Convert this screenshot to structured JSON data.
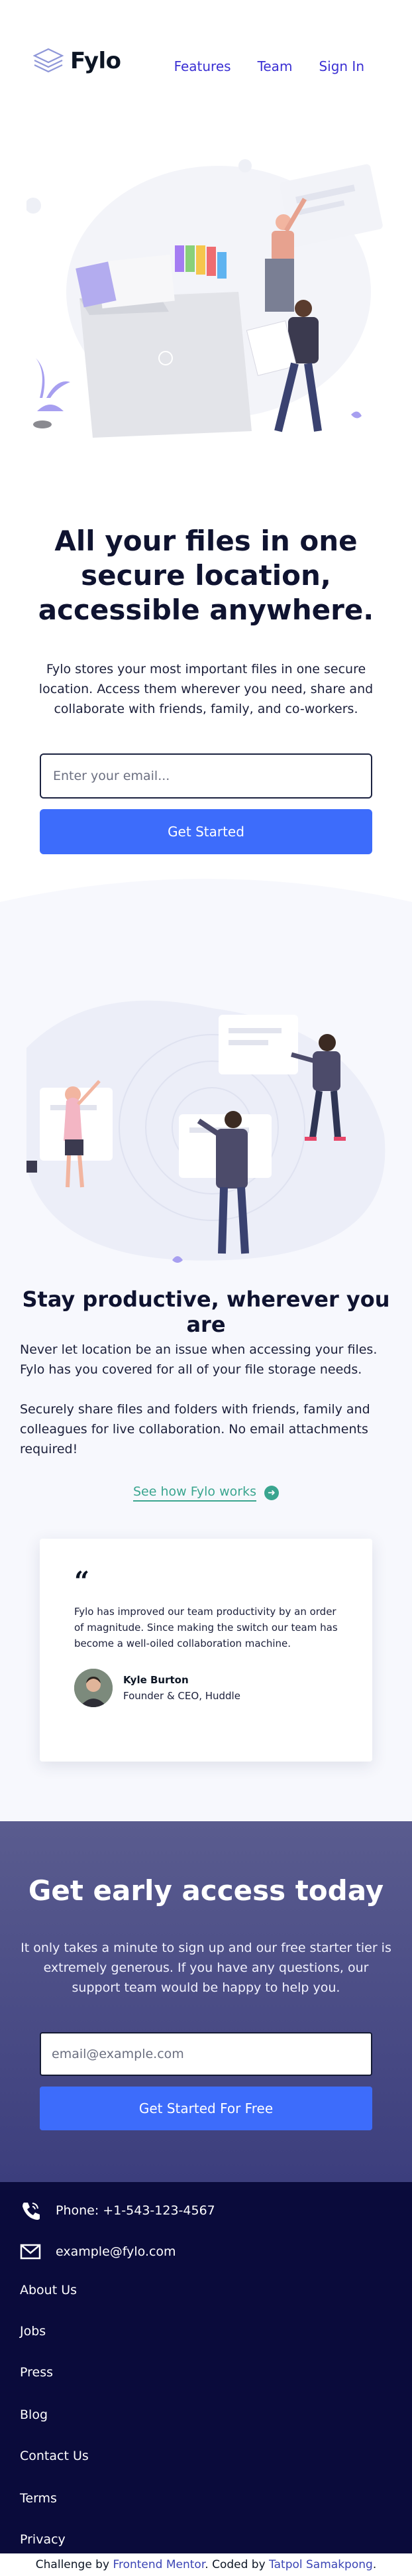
{
  "header": {
    "logo_text": "Fylo",
    "nav": [
      "Features",
      "Team",
      "Sign In"
    ]
  },
  "hero": {
    "title": "All your files in one secure location, accessible anywhere.",
    "text": "Fylo stores your most important files in one secure location. Access them wherever you need, share and collaborate with friends, family, and co-workers.",
    "email_placeholder": "Enter your email...",
    "button": "Get Started"
  },
  "productive": {
    "title": "Stay productive, wherever you are",
    "p1": "Never let location be an issue when accessing your files. Fylo has you covered for all of your file storage needs.",
    "p2": "Securely share files and folders with friends, family and colleagues for live collaboration. No email attachments required!",
    "link": "See how Fylo works"
  },
  "testimonial": {
    "quote": "Fylo has improved our team productivity by an order of magnitude. Since making the switch our team has become a well-oiled collaboration machine.",
    "name": "Kyle Burton",
    "role": "Founder & CEO, Huddle"
  },
  "early_access": {
    "title": "Get early access today",
    "text": "It only takes a minute to sign up and our free starter tier is extremely generous. If you have any questions, our support team would be happy to help you.",
    "email_placeholder": "email@example.com",
    "button": "Get Started For Free"
  },
  "footer": {
    "phone": "Phone: +1-543-123-4567",
    "email": "example@fylo.com",
    "links": [
      "About Us",
      "Jobs",
      "Press",
      "Blog",
      "Contact Us",
      "Terms",
      "Privacy"
    ]
  },
  "attribution": {
    "prefix": "Challenge by",
    "challenge_link": "Frontend Mentor",
    "middle": ". Coded by",
    "coder_link": "Tatpol Samakpong",
    "suffix": "."
  },
  "colors": {
    "accent": "#3d6cfb",
    "nav_link": "#3a2fd3",
    "teal_link": "#3aa58f",
    "footer_bg": "#0a0b3b",
    "early_bg": "#4b4d86"
  }
}
